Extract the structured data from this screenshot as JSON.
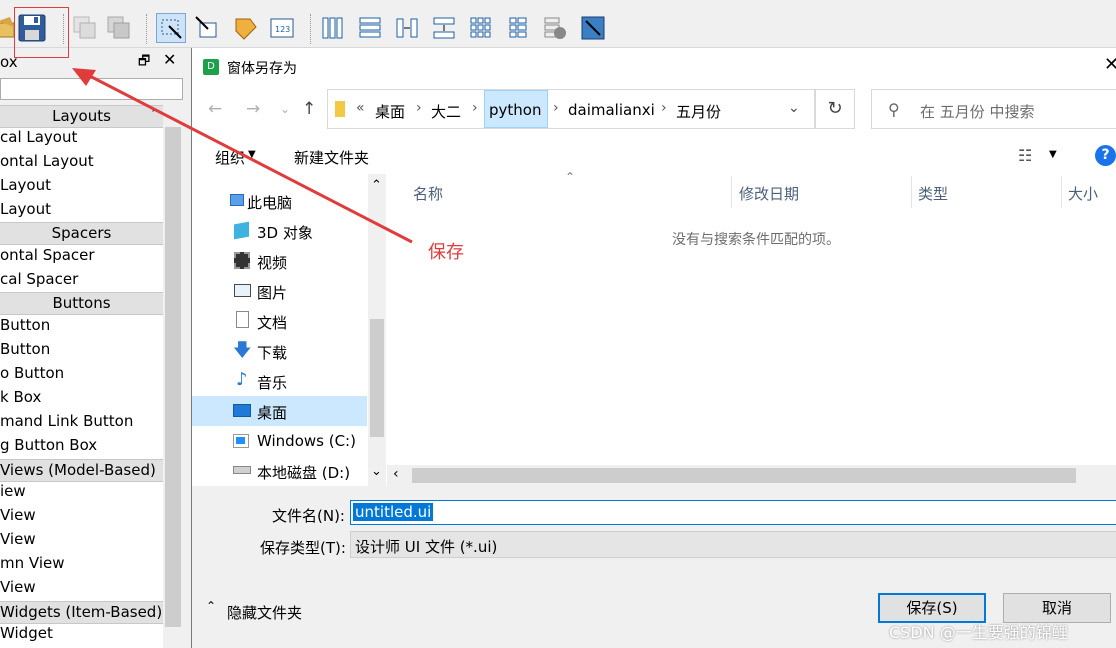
{
  "app": {
    "widget_box": {
      "title": "ox",
      "categories": {
        "layouts": "Layouts",
        "spacers": "Spacers",
        "buttons": "Buttons",
        "item_views": "Views (Model-Based)",
        "item_widgets": "Widgets (Item-Based)"
      },
      "items": [
        {
          "label": "cal Layout"
        },
        {
          "label": "ontal Layout"
        },
        {
          "label": "Layout"
        },
        {
          "label": " Layout"
        },
        {
          "label": "ontal Spacer"
        },
        {
          "label": "cal Spacer"
        },
        {
          "label": "Button"
        },
        {
          "label": "Button"
        },
        {
          "label": "o Button"
        },
        {
          "label": "k Box"
        },
        {
          "label": "mand Link Button"
        },
        {
          "label": "g Button Box"
        },
        {
          "label": "iew"
        },
        {
          "label": "View"
        },
        {
          "label": " View"
        },
        {
          "label": "mn View"
        },
        {
          "label": " View"
        },
        {
          "label": "Widget"
        }
      ]
    }
  },
  "dialog": {
    "title": "窗体另存为",
    "breadcrumb": [
      "桌面",
      "大二",
      "python",
      "daimalianxi",
      "五月份"
    ],
    "search_placeholder": "在 五月份 中搜索",
    "toolbar": {
      "organize": "组织",
      "new_folder": "新建文件夹"
    },
    "nav": [
      {
        "label": "此电脑",
        "icon": "computer-icon"
      },
      {
        "label": "3D 对象",
        "icon": "cube-icon"
      },
      {
        "label": "视频",
        "icon": "film-icon"
      },
      {
        "label": "图片",
        "icon": "picture-icon"
      },
      {
        "label": "文档",
        "icon": "document-icon"
      },
      {
        "label": "下载",
        "icon": "download-icon"
      },
      {
        "label": "音乐",
        "icon": "music-icon"
      },
      {
        "label": "桌面",
        "icon": "desktop-icon"
      },
      {
        "label": "Windows  (C:)",
        "icon": "windows-drive-icon"
      },
      {
        "label": "本地磁盘 (D:)",
        "icon": "drive-icon"
      }
    ],
    "columns": {
      "name": "名称",
      "modified": "修改日期",
      "type": "类型",
      "size": "大小"
    },
    "empty_message": "没有与搜索条件匹配的项。",
    "filename_label": "文件名(N):",
    "filename_value": "untitled.ui",
    "filetype_label": "保存类型(T):",
    "filetype_value": "设计师 UI 文件 (*.ui)",
    "hide_folders": "隐藏文件夹",
    "save_button": "保存(S)",
    "cancel_button": "取消"
  },
  "annotation": {
    "text": "保存",
    "color": "#e03c3c"
  },
  "watermark": "CSDN @一生要强的锦鲤"
}
